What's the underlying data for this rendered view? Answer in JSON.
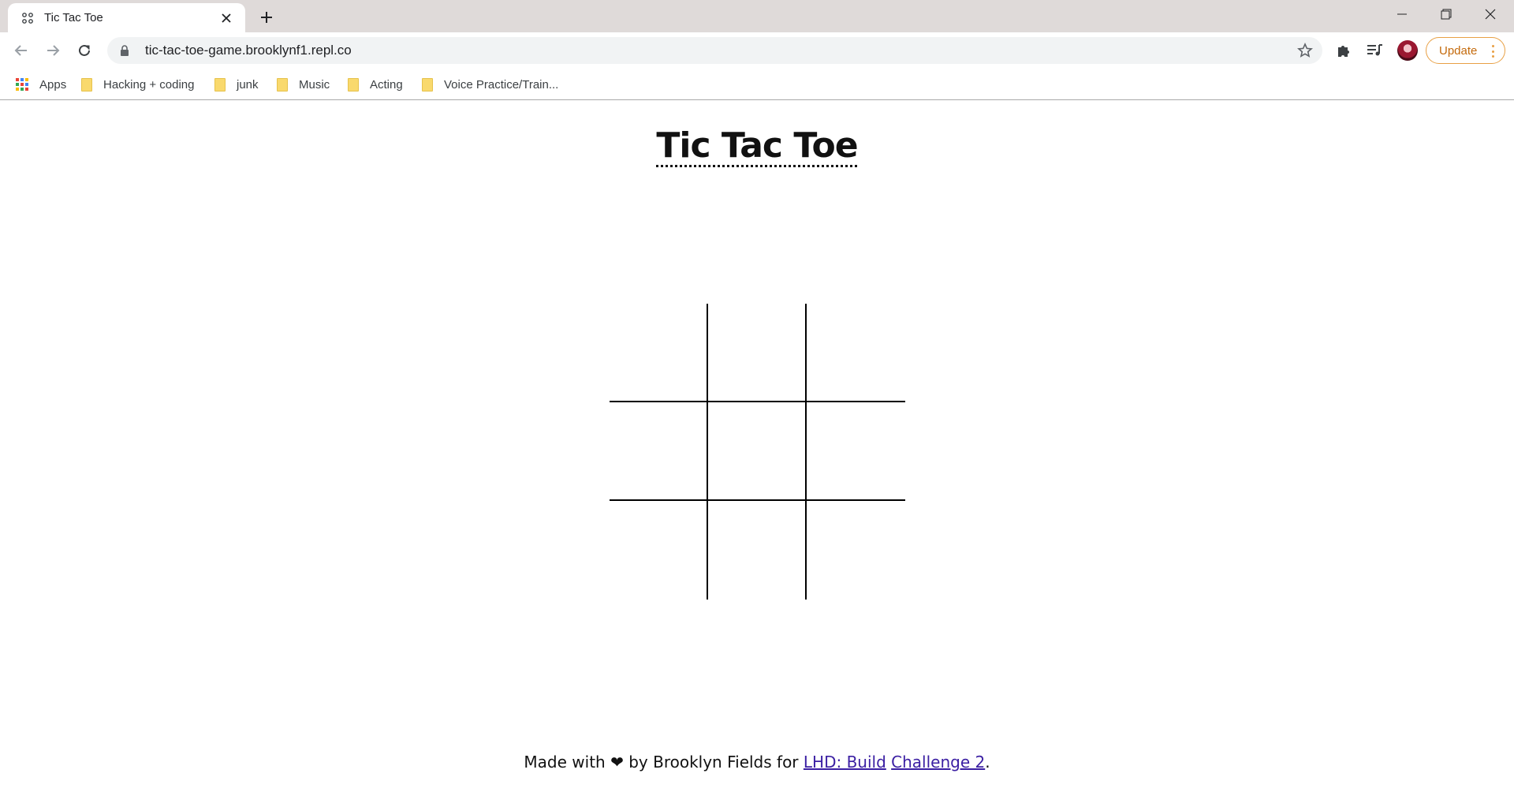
{
  "browser": {
    "tab": {
      "title": "Tic Tac Toe",
      "favicon": "replit-icon"
    },
    "address_bar": {
      "url": "tic-tac-toe-game.brooklynf1.repl.co"
    },
    "update_button": {
      "label": "Update"
    },
    "bookmarks": [
      {
        "label": "Apps",
        "icon": "apps-grid-icon"
      },
      {
        "label": "Hacking + coding",
        "icon": "folder-icon"
      },
      {
        "label": "junk",
        "icon": "folder-icon"
      },
      {
        "label": "Music",
        "icon": "folder-icon"
      },
      {
        "label": "Acting",
        "icon": "folder-icon"
      },
      {
        "label": "Voice Practice/Train...",
        "icon": "folder-icon"
      }
    ]
  },
  "page": {
    "title": "Tic Tac Toe",
    "board": [
      "",
      "",
      "",
      "",
      "",
      "",
      "",
      "",
      ""
    ],
    "footer": {
      "prefix": "Made with",
      "heart": "❤",
      "middle": "by Brooklyn Fields for",
      "link1": "LHD: Build",
      "link2": "Challenge 2",
      "suffix": "."
    }
  },
  "colors": {
    "accent_update": "#e8a045",
    "link": "#3b1fa3",
    "tabstrip": "#dfdad9"
  }
}
